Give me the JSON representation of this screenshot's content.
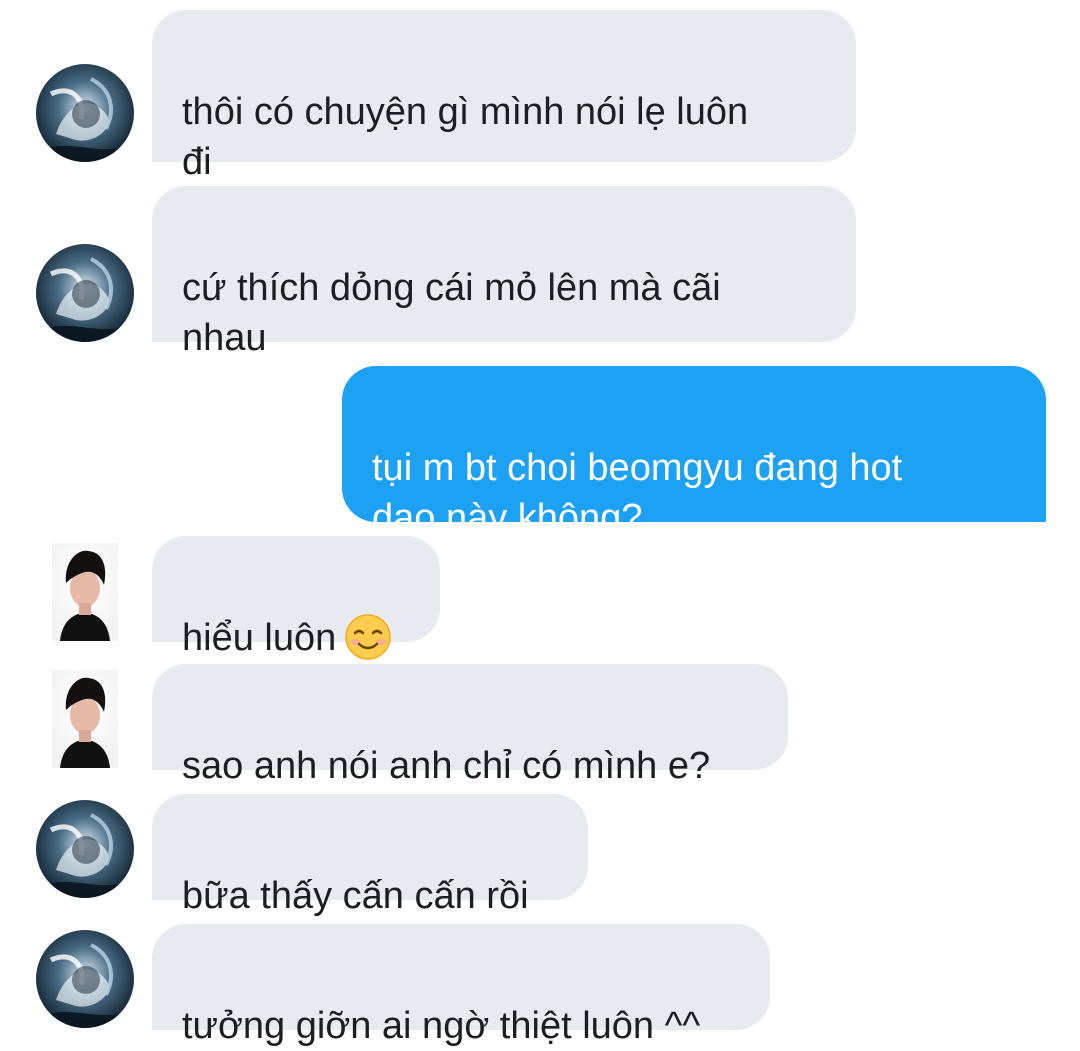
{
  "chat": {
    "messages": [
      {
        "sender": "them",
        "avatar": "smoke-portrait-avatar",
        "text": "thôi có chuyện gì mình nói lẹ luôn\nđi"
      },
      {
        "sender": "them",
        "avatar": "smoke-portrait-avatar",
        "text": "cứ thích dỏng cái mỏ lên mà cãi\nnhau"
      },
      {
        "sender": "me",
        "text": "tụi m bt choi beomgyu đang hot\ndạo này không?"
      },
      {
        "sender": "them",
        "avatar": "dark-haired-person-avatar",
        "text": "hiểu luôn",
        "emoji": "smiling-face-emoji"
      },
      {
        "sender": "them",
        "avatar": "dark-haired-person-avatar",
        "text": "sao anh nói anh chỉ có mình e?"
      },
      {
        "sender": "them",
        "avatar": "smoke-portrait-avatar",
        "text": "bữa thấy cấn cấn rồi"
      },
      {
        "sender": "them",
        "avatar": "smoke-portrait-avatar",
        "text": "tưởng giỡn ai ngờ thiệt luôn ^^"
      }
    ]
  },
  "colors": {
    "incoming_bubble": "#e7eaef",
    "outgoing_bubble": "#1da1f2",
    "incoming_text": "#1c1e21",
    "outgoing_text": "#ffffff"
  }
}
